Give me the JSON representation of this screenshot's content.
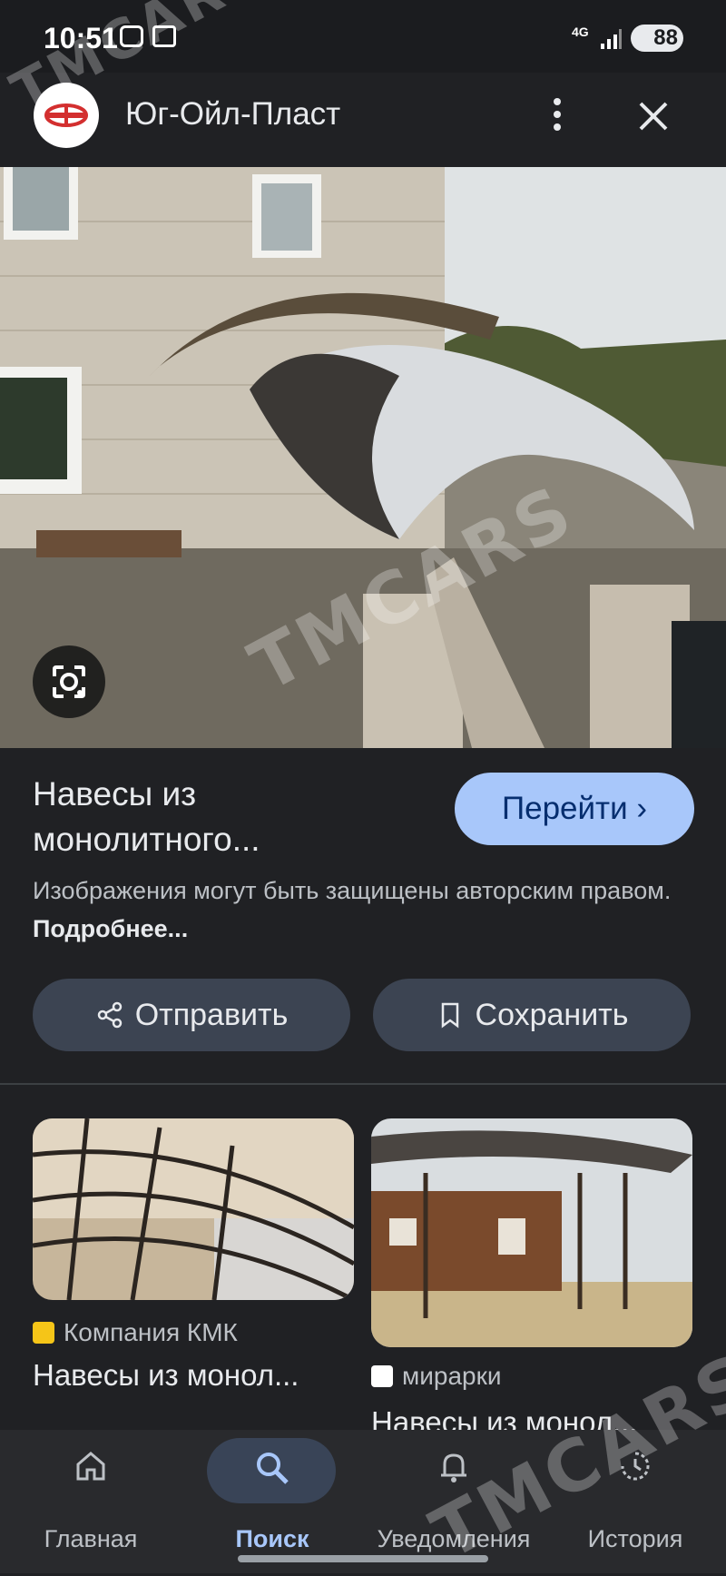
{
  "status_bar": {
    "time": "10:51",
    "network": "4G",
    "battery": "88"
  },
  "header": {
    "site_name": "Юг-Ойл-Пласт"
  },
  "result": {
    "title_line1": "Навесы из",
    "title_line2": "монолитного...",
    "visit_label": "Перейти",
    "copyright_text": "Изображения могут быть защищены авторским правом.",
    "more_link": "Подробнее..."
  },
  "actions": {
    "share_label": "Отправить",
    "save_label": "Сохранить"
  },
  "related": [
    {
      "source": "Компания КМК",
      "title": "Навесы из монол..."
    },
    {
      "source": "мирарки",
      "title": "Навесы из монол..."
    }
  ],
  "bottom_nav": [
    {
      "label": "Главная",
      "active": false
    },
    {
      "label": "Поиск",
      "active": true
    },
    {
      "label": "Уведомления",
      "active": false
    },
    {
      "label": "История",
      "active": false
    }
  ],
  "watermark": "TMCARS",
  "colors": {
    "accent": "#a8c7fa",
    "active_nav": "#a8c7fa",
    "background": "#202124"
  }
}
